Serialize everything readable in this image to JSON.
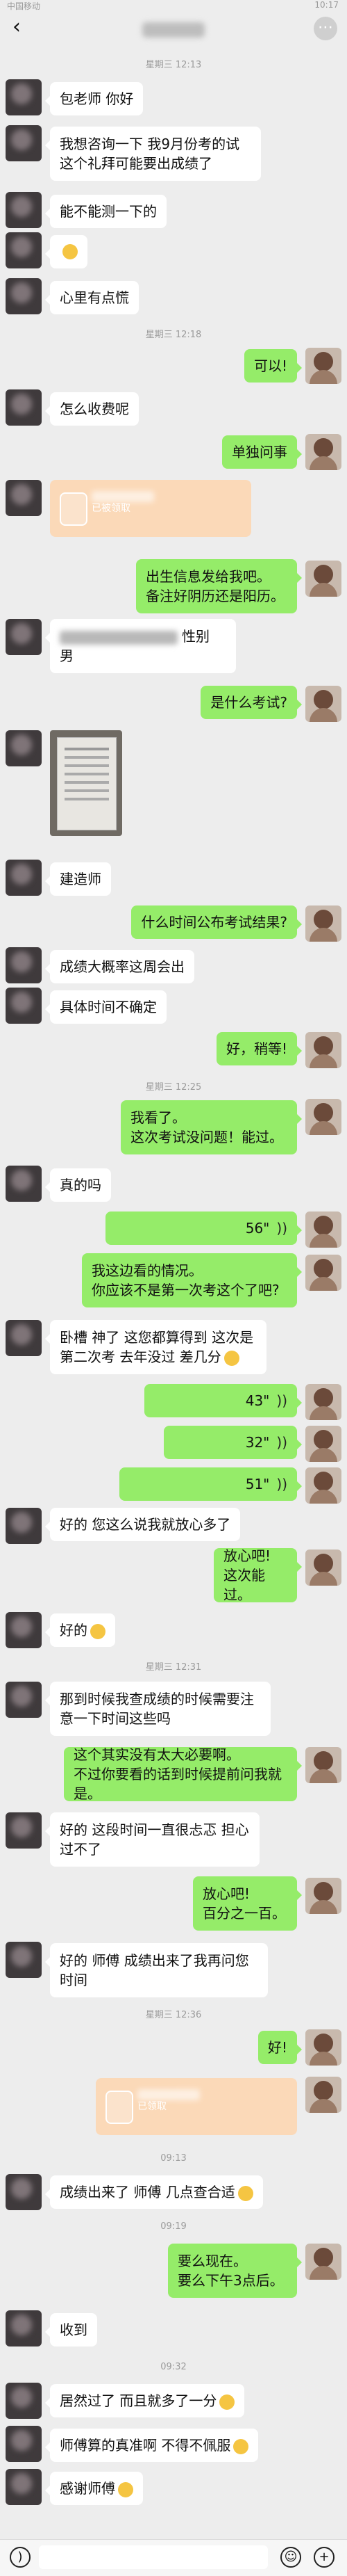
{
  "status": {
    "left": "中国移动",
    "right": "10:17"
  },
  "header": {
    "back_icon": "chevron-left-icon",
    "more_icon": "more-icon"
  },
  "times": {
    "t1": "星期三 12:13",
    "t2": "星期三 12:18",
    "t3": "星期三 12:25",
    "t4": "星期三 12:31",
    "t5": "星期三 12:36",
    "t6": "09:13",
    "t7": "09:19",
    "t8": "09:32"
  },
  "messages": {
    "m1": "包老师 你好",
    "m2": "我想咨询一下  我9月份考的试  这个礼拜可能要出成绩了",
    "m3": "能不能测一下的",
    "m4": "心里有点慌",
    "m5": "可以!",
    "m6": "怎么收费呢",
    "m7": "单独问事",
    "m8": "已被领取",
    "m9": "出生信息发给我吧。\n备注好阴历还是阳历。",
    "m10": "性别",
    "m10b": "男",
    "m11": "是什么考试?",
    "m12": "建造师",
    "m13": "什么时间公布考试结果?",
    "m14": "成绩大概率这周会出",
    "m15": "具体时间不确定",
    "m16": "好，稍等!",
    "m17": "我看了。\n这次考试没问题！能过。",
    "m18": "真的吗",
    "m19": "56\"",
    "m20": "我这边看的情况。\n你应该不是第一次考这个了吧?",
    "m21": "卧槽 神了 这您都算得到 这次是第二次考 去年没过 差几分",
    "m22": "43\"",
    "m23": "32\"",
    "m24": "51\"",
    "m25": "好的 您这么说我就放心多了",
    "m26": "放心吧!\n这次能过。",
    "m27": "好的",
    "m28": "那到时候我查成绩的时候需要注意一下时间这些吗",
    "m29": "这个其实没有太大必要啊。\n不过你要看的话到时候提前问我就是。",
    "m30": "好的 这段时间一直很忐忑 担心过不了",
    "m31": "放心吧!\n百分之一百。",
    "m32": "好的 师傅 成绩出来了我再问您时间",
    "m33": "好!",
    "m34": "已领取",
    "m35": "成绩出来了 师傅 几点查合适",
    "m36": "要么现在。\n要么下午3点后。",
    "m37": "收到",
    "m38": "居然过了 而且就多了一分",
    "m39": "师傅算的真准啊 不得不佩服",
    "m40": "感谢师傅"
  },
  "inputbar": {
    "voice_icon": "voice-icon",
    "emoji_icon": "emoji-icon",
    "plus_icon": "plus-icon"
  }
}
